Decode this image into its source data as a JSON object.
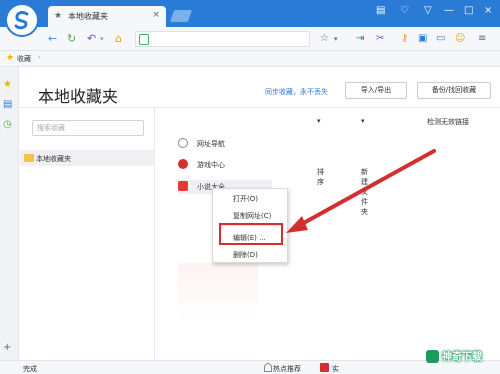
{
  "titlebar": {
    "tab_title": "本地收藏夹",
    "tab_close": "×",
    "tab_icon": "star-icon",
    "window_controls": [
      "menu-icon",
      "minimize-icon",
      "maximize-icon",
      "close-icon"
    ]
  },
  "bookmarks_bar": {
    "label": "收藏",
    "arrow": "›"
  },
  "page": {
    "title": "本地收藏夹",
    "sync_text": "同步收藏，永不丢失",
    "import_export_label": "导入/导出",
    "backup_label": "备份/找回收藏",
    "search_placeholder": "搜索收藏",
    "folder_label": "本地收藏夹",
    "toolbar": {
      "sort_label": "排序",
      "new_folder_label": "新建文件夹",
      "check_links_label": "检测无效链接"
    },
    "items": [
      {
        "label": "网址导航",
        "icon_color": "#888888"
      },
      {
        "label": "游戏中心",
        "icon_color": "#d32f2f"
      },
      {
        "label": "小说大全",
        "icon_color": "#e53935"
      }
    ]
  },
  "context_menu": {
    "items": [
      "打开(O)",
      "复制网址(C)",
      "编辑(E) ...",
      "删除(D)"
    ],
    "highlighted": "编辑(E) ..."
  },
  "statusbar": {
    "status_text": "完成",
    "hot_recommend": "热点推荐",
    "red_label": "实",
    "watermark": "神奇下载"
  },
  "colors": {
    "accent": "#2a7bd6",
    "highlight": "#d32f2f"
  }
}
